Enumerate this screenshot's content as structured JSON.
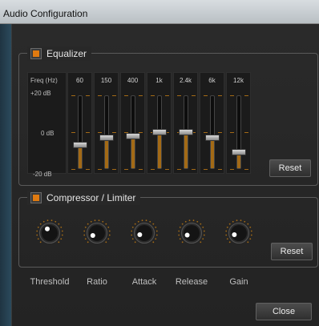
{
  "window": {
    "title": "Audio Configuration"
  },
  "equalizer": {
    "label": "Equalizer",
    "enabled": true,
    "scale": {
      "header": "Freq (Hz)",
      "top": "+20 dB",
      "mid": "0 dB",
      "bottom": "-20 dB"
    },
    "bands": [
      {
        "freq": "60",
        "gain_db": -7
      },
      {
        "freq": "150",
        "gain_db": -3
      },
      {
        "freq": "400",
        "gain_db": -2
      },
      {
        "freq": "1k",
        "gain_db": 0
      },
      {
        "freq": "2.4k",
        "gain_db": 0
      },
      {
        "freq": "6k",
        "gain_db": -3
      },
      {
        "freq": "12k",
        "gain_db": -11
      }
    ],
    "reset_label": "Reset"
  },
  "compressor": {
    "label": "Compressor / Limiter",
    "enabled": true,
    "knobs": [
      {
        "label": "Threshold",
        "angle_deg": -30
      },
      {
        "label": "Ratio",
        "angle_deg": -120
      },
      {
        "label": "Attack",
        "angle_deg": -110
      },
      {
        "label": "Release",
        "angle_deg": -115
      },
      {
        "label": "Gain",
        "angle_deg": -110
      }
    ],
    "reset_label": "Reset"
  },
  "footer": {
    "close_label": "Close"
  },
  "colors": {
    "accent": "#e07a10",
    "fill": "#a36a16",
    "knob_dot": "#ffffff"
  }
}
